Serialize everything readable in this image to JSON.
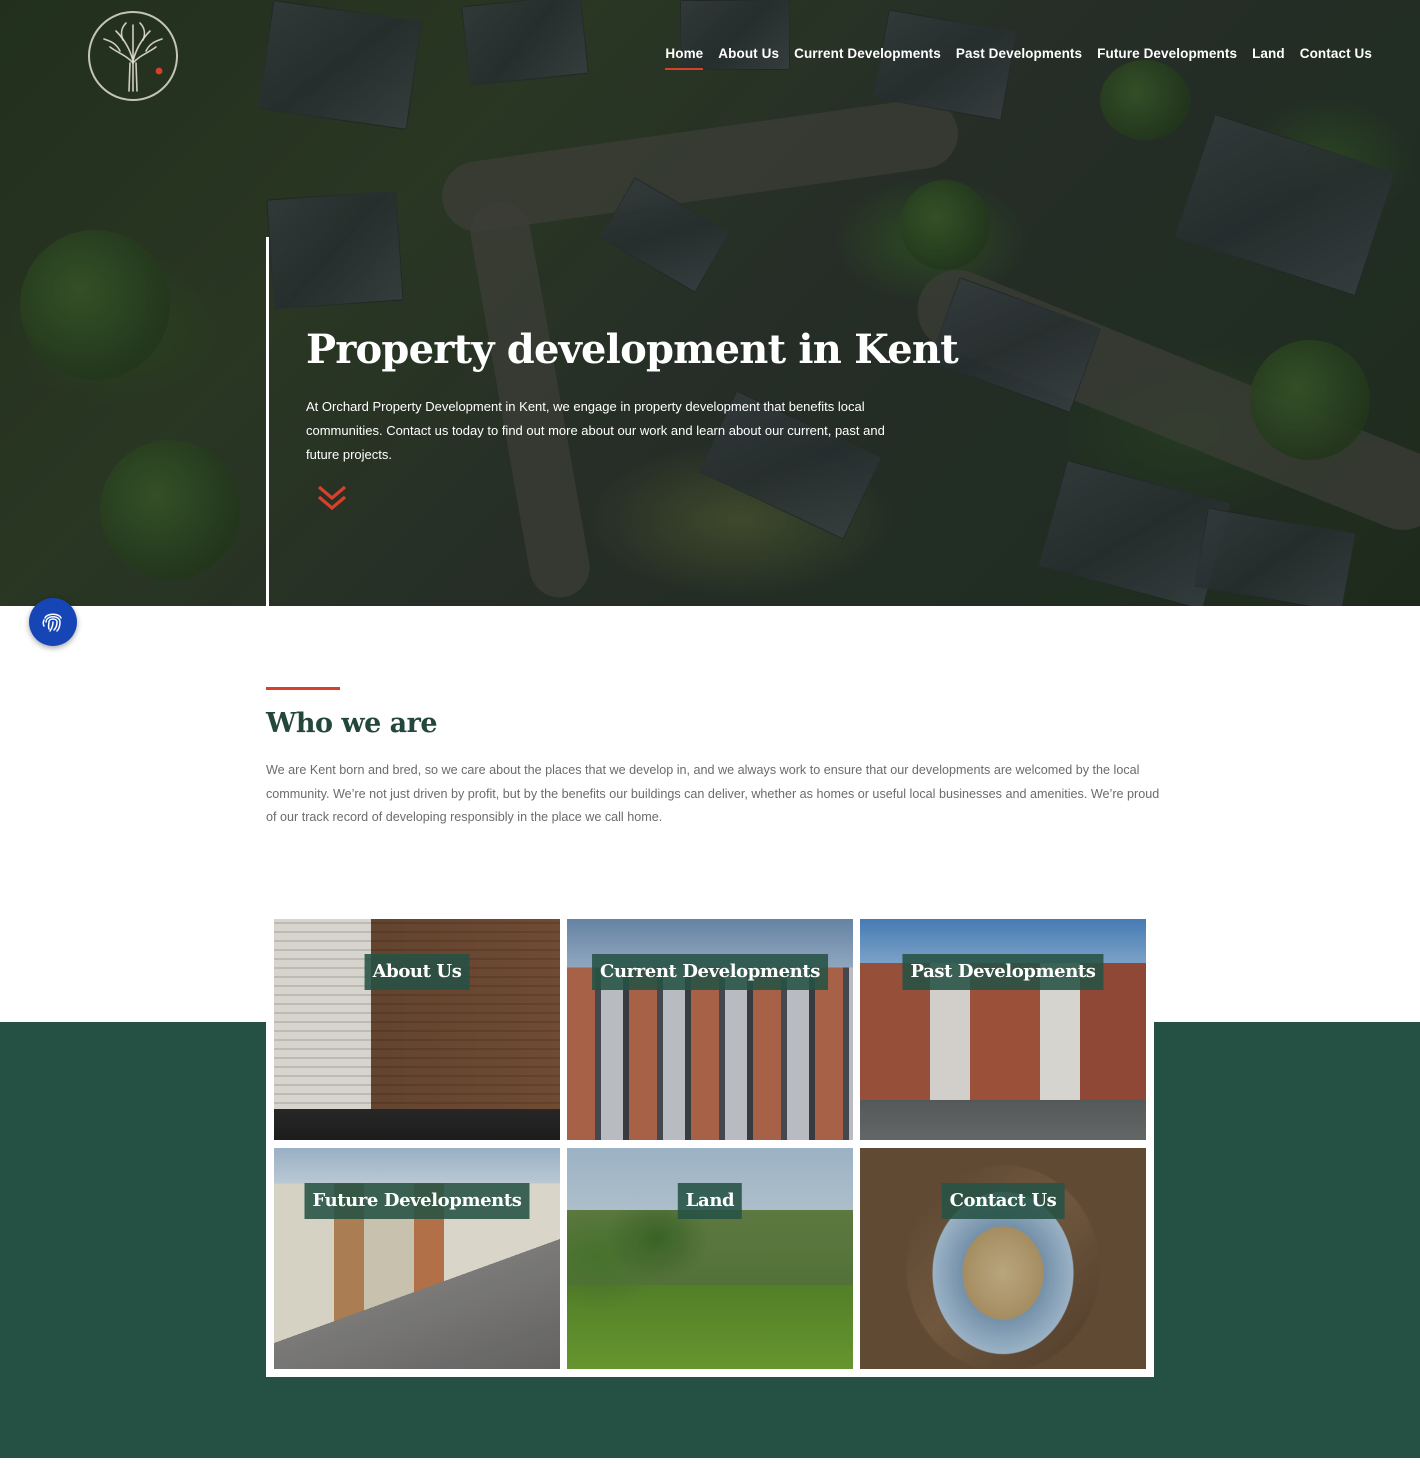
{
  "nav": {
    "items": [
      {
        "label": "Home",
        "active": true
      },
      {
        "label": "About Us",
        "active": false
      },
      {
        "label": "Current Developments",
        "active": false
      },
      {
        "label": "Past Developments",
        "active": false
      },
      {
        "label": "Future Developments",
        "active": false
      },
      {
        "label": "Land",
        "active": false
      },
      {
        "label": "Contact Us",
        "active": false
      }
    ]
  },
  "hero": {
    "title": "Property development in Kent",
    "text": "At Orchard Property Development in Kent, we engage in property development that benefits local communities. Contact us today to find out more about our work and learn about our current, past and future projects."
  },
  "who": {
    "title": "Who we are",
    "text": "We are Kent born and bred, so we care about the places that we develop in, and we always work to ensure that our developments are welcomed by the local community. We’re not just driven by profit, but by the benefits our buildings can deliver, whether as homes or useful local businesses and amenities. We’re proud of our track record of developing responsibly in the place we call home."
  },
  "tiles": [
    {
      "label": "About Us"
    },
    {
      "label": "Current Developments"
    },
    {
      "label": "Past Developments"
    },
    {
      "label": "Future Developments"
    },
    {
      "label": "Land"
    },
    {
      "label": "Contact Us"
    }
  ],
  "colors": {
    "accent": "#d8402c",
    "brand_green": "#245144",
    "heading_green": "#23473c",
    "accessibility_blue": "#1646b6"
  },
  "icons": {
    "logo": "tree-logo-icon",
    "scroll": "double-chevron-down-icon",
    "accessibility": "fingerprint-icon"
  }
}
